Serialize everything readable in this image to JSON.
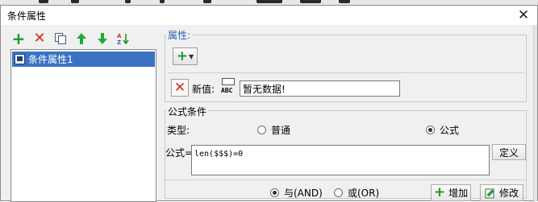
{
  "dialog": {
    "title": "条件属性",
    "close_glyph": "✕"
  },
  "left_toolbar": {
    "icons": [
      "add-icon",
      "delete-icon",
      "copy-icon",
      "move-up-icon",
      "move-down-icon",
      "sort-icon"
    ]
  },
  "condition_list": {
    "items": [
      {
        "label": "条件属性1",
        "selected": true
      }
    ]
  },
  "properties": {
    "group_label": "属性:",
    "new_value_label": "新值:",
    "new_value": "暂无数据!"
  },
  "formula_condition": {
    "group_label": "公式条件",
    "type_label": "类型:",
    "type_options": [
      {
        "label": "普通",
        "selected": false
      },
      {
        "label": "公式",
        "selected": true
      }
    ],
    "formula_label": "公式=",
    "formula_value": "len($$$)=0",
    "define_button": "定义"
  },
  "logic": {
    "options": [
      {
        "label": "与(AND)",
        "selected": true
      },
      {
        "label": "或(OR)",
        "selected": false
      }
    ],
    "add_button": "增加",
    "modify_button": "修改"
  },
  "colors": {
    "selection": "#3b73c4",
    "green": "#1b9a2a",
    "red": "#d42a1e"
  }
}
